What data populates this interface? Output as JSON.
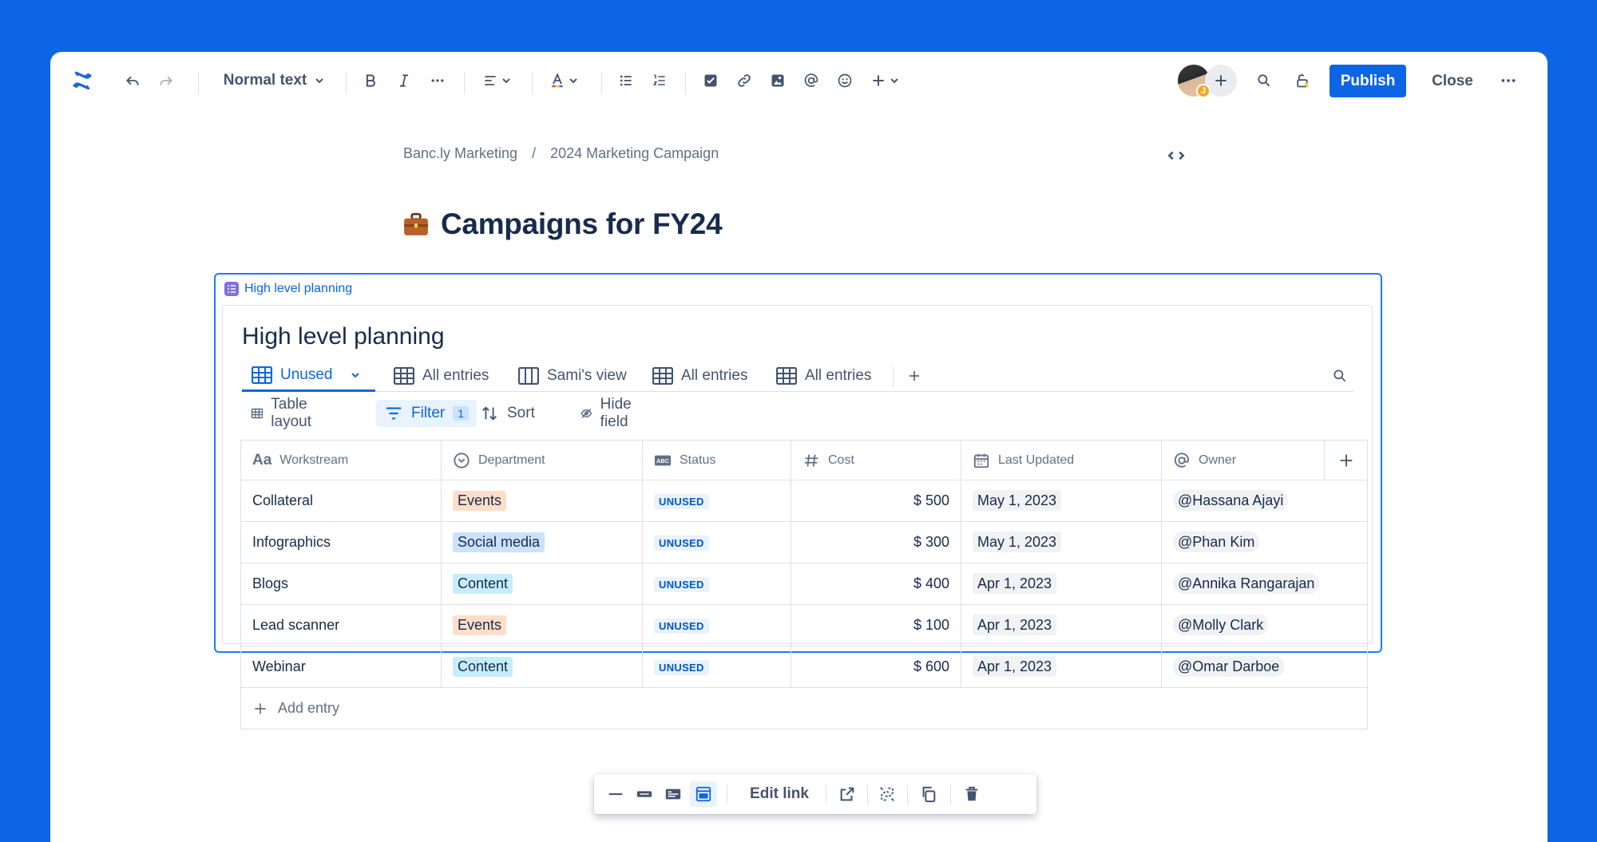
{
  "toolbar": {
    "text_style": "Normal text",
    "publish_label": "Publish",
    "close_label": "Close",
    "avatar_initial": "J"
  },
  "breadcrumbs": [
    "Banc.ly Marketing",
    "/",
    "2024 Marketing Campaign"
  ],
  "page": {
    "title": "Campaigns for FY24"
  },
  "database": {
    "embed_label": "High level planning",
    "title": "High level planning",
    "views": [
      "Unused",
      "All entries",
      "Sami's view",
      "All entries",
      "All entries"
    ],
    "actions": {
      "layout": "Table layout",
      "filter": "Filter",
      "filter_count": "1",
      "sort": "Sort",
      "hide": "Hide field"
    },
    "columns": [
      "Workstream",
      "Department",
      "Status",
      "Cost",
      "Last Updated",
      "Owner"
    ],
    "rows": [
      {
        "workstream": "Collateral",
        "department": "Events",
        "status": "UNUSED",
        "cost": "$ 500",
        "updated": "May 1, 2023",
        "owner": "Hassana Ajayi"
      },
      {
        "workstream": "Infographics",
        "department": "Social media",
        "status": "UNUSED",
        "cost": "$ 300",
        "updated": "May 1, 2023",
        "owner": "Phan Kim"
      },
      {
        "workstream": "Blogs",
        "department": "Content",
        "status": "UNUSED",
        "cost": "$ 400",
        "updated": "Apr 1, 2023",
        "owner": "Annika Rangarajan"
      },
      {
        "workstream": "Lead scanner",
        "department": "Events",
        "status": "UNUSED",
        "cost": "$ 100",
        "updated": "Apr 1, 2023",
        "owner": "Molly Clark"
      },
      {
        "workstream": "Webinar",
        "department": "Content",
        "status": "UNUSED",
        "cost": "$ 600",
        "updated": "Apr 1, 2023",
        "owner": "Omar Darboe"
      }
    ],
    "add_entry": "Add entry"
  },
  "floating_toolbar": {
    "edit_link": "Edit link"
  },
  "colors": {
    "background": "#0c66e4",
    "accent": "#0c66e4"
  }
}
